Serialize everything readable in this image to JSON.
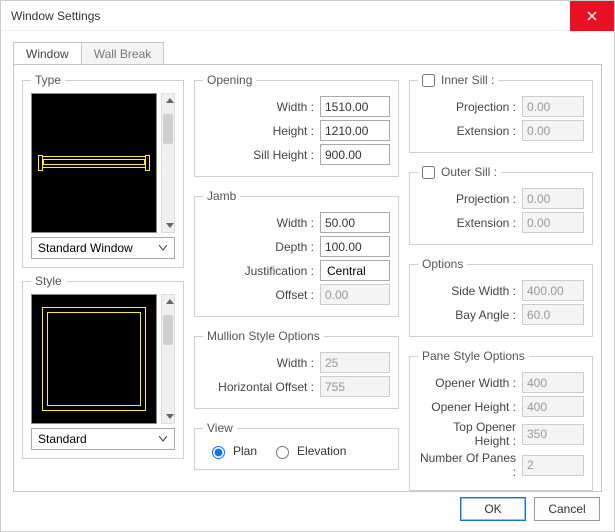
{
  "dialog": {
    "title": "Window Settings"
  },
  "tabs": {
    "window": "Window",
    "wallbreak": "Wall Break"
  },
  "type": {
    "legend": "Type",
    "selected": "Standard Window"
  },
  "style": {
    "legend": "Style",
    "selected": "Standard"
  },
  "opening": {
    "legend": "Opening",
    "width_label": "Width :",
    "width": "1510.00",
    "height_label": "Height :",
    "height": "1210.00",
    "sill_label": "Sill Height :",
    "sill": "900.00"
  },
  "jamb": {
    "legend": "Jamb",
    "width_label": "Width :",
    "width": "50.00",
    "depth_label": "Depth :",
    "depth": "100.00",
    "just_label": "Justification :",
    "just": "Central",
    "offset_label": "Offset :",
    "offset": "0.00"
  },
  "mullion": {
    "legend": "Mullion Style Options",
    "width_label": "Width :",
    "width": "25",
    "hoff_label": "Horizontal Offset :",
    "hoff": "755"
  },
  "view": {
    "legend": "View",
    "plan": "Plan",
    "elevation": "Elevation"
  },
  "inner_sill": {
    "legend": "Inner Sill :",
    "proj_label": "Projection :",
    "proj": "0.00",
    "ext_label": "Extension :",
    "ext": "0.00"
  },
  "outer_sill": {
    "legend": "Outer Sill :",
    "proj_label": "Projection :",
    "proj": "0.00",
    "ext_label": "Extension :",
    "ext": "0.00"
  },
  "options": {
    "legend": "Options",
    "sw_label": "Side Width :",
    "sw": "400.00",
    "ba_label": "Bay Angle :",
    "ba": "60.0"
  },
  "pane": {
    "legend": "Pane Style Options",
    "ow_label": "Opener Width :",
    "ow": "400",
    "oh_label": "Opener Height :",
    "oh": "400",
    "toh_label": "Top Opener Height :",
    "toh": "350",
    "np_label": "Number Of Panes :",
    "np": "2"
  },
  "buttons": {
    "ok": "OK",
    "cancel": "Cancel"
  }
}
